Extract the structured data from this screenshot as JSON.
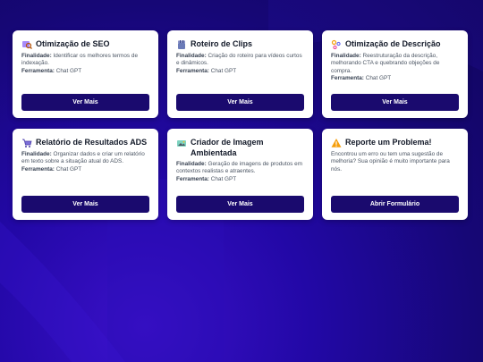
{
  "cards": [
    {
      "title": "Otimização de SEO",
      "icon": "seo-icon",
      "purpose_label": "Finalidade:",
      "purpose": "Identificar os melhores termos de indexação.",
      "tool_label": "Ferramenta:",
      "tool": "Chat GPT",
      "button": "Ver Mais"
    },
    {
      "title": "Roteiro de Clips",
      "icon": "clapper-icon",
      "purpose_label": "Finalidade:",
      "purpose": "Criação do roteiro para vídeos curtos e dinâmicos.",
      "tool_label": "Ferramenta:",
      "tool": "Chat GPT",
      "button": "Ver Mais"
    },
    {
      "title": "Otimização de Descrição",
      "icon": "sparkle-icon",
      "purpose_label": "Finalidade:",
      "purpose": "Reestruturação da descrição, melhorando CTA e quebrando objeções de compra.",
      "tool_label": "Ferramenta:",
      "tool": "Chat GPT",
      "button": "Ver Mais"
    },
    {
      "title": "Relatório de Resultados ADS",
      "icon": "cart-icon",
      "purpose_label": "Finalidade:",
      "purpose": "Organizar dados e criar um relatório em texto sobre a situação atual do ADS.",
      "tool_label": "Ferramenta:",
      "tool": "Chat GPT",
      "button": "Ver Mais"
    },
    {
      "title": "Criador de Imagem Ambientada",
      "icon": "image-icon",
      "purpose_label": "Finalidade:",
      "purpose": "Geração de imagens de produtos em contextos realistas e atraentes.",
      "tool_label": "Ferramenta:",
      "tool": "Chat GPT",
      "button": "Ver Mais"
    }
  ],
  "report": {
    "title": "Reporte um Problema!",
    "icon": "warning-icon",
    "text": "Encontrou um erro ou tem uma sugestão de melhoria? Sua opinião é muito importante para nós.",
    "button": "Abrir Formulário"
  },
  "colors": {
    "button": "#1a0a6e",
    "background": "#1a0891",
    "warning": "#f59e0b"
  }
}
